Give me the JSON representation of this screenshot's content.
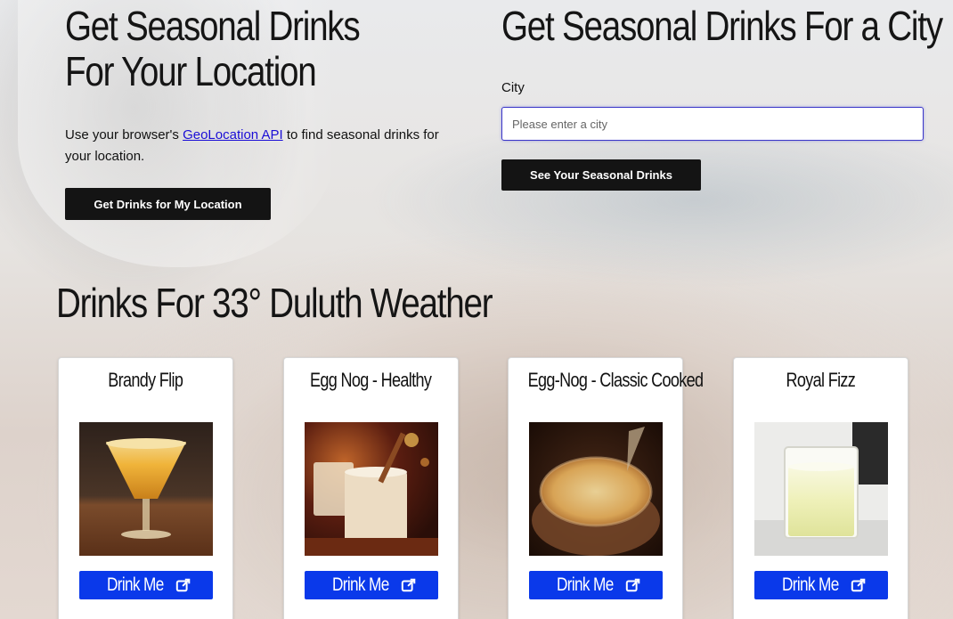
{
  "location_section": {
    "title_line1": "Get Seasonal Drinks",
    "title_line2": "For Your Location",
    "intro_prefix": "Use your browser's ",
    "intro_link": "GeoLocation API",
    "intro_suffix": " to find seasonal drinks for your location.",
    "button_label": "Get Drinks for My Location"
  },
  "city_section": {
    "title": "Get Seasonal Drinks For a City",
    "label": "City",
    "input_value": "",
    "input_placeholder": "Please enter a city",
    "button_label": "See Your Seasonal Drinks"
  },
  "results": {
    "title": "Drinks For 33° Duluth Weather",
    "drinks": [
      {
        "name": "Brandy Flip",
        "button_label": "Drink Me"
      },
      {
        "name": "Egg Nog - Healthy",
        "button_label": "Drink Me"
      },
      {
        "name": "Egg-Nog - Classic Cooked",
        "button_label": "Drink Me"
      },
      {
        "name": "Royal Fizz",
        "button_label": "Drink Me"
      }
    ]
  },
  "colors": {
    "link": "#1a0dd6",
    "dark_button": "#141414",
    "blue_button": "#0a39ea",
    "input_focus_border": "#3a36c8"
  },
  "icons": {
    "card_button_icon": "external-link-icon"
  }
}
